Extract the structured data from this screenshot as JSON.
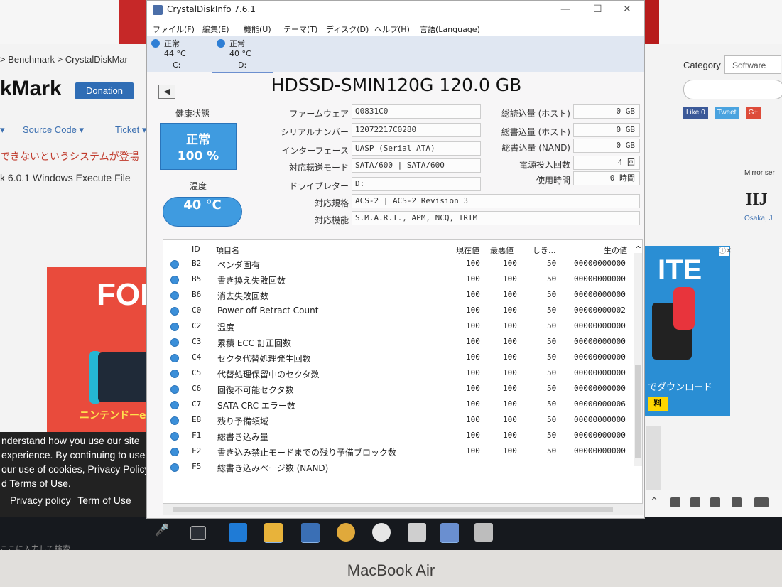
{
  "browser": {
    "breadcrumb": "> Benchmark > CrystalDiskMar",
    "site_title": "kMark",
    "donation_label": "Donation",
    "nav_source": "Source Code",
    "nav_ticket": "Ticket",
    "red_text": "できないというシステムが登場",
    "exec_text": "k 6.0.1 Windows Execute File",
    "category_label": "Category",
    "category_value": "Software",
    "like_label": "Like 0",
    "tweet_label": "Tweet",
    "gplus_label": "G+",
    "mirror_label": "Mirror ser",
    "iij_label": "IIJ",
    "osaka_label": "Osaka, J",
    "ad_left_big": "FORT",
    "ad_left_bottom": "ニンテンドーeショ",
    "ad_right_big": "ITE",
    "ad_right_download": "でダウンロード",
    "ad_right_buy": "料",
    "ad_close": "ⓘ✕",
    "cookie_lines": [
      "nderstand how you use our site",
      " experience. By continuing to use",
      " our use of cookies, Privacy Policy",
      "d Terms of Use."
    ],
    "privacy_link": "Privacy policy",
    "terms_link": "Term of Use"
  },
  "window": {
    "title": "CrystalDiskInfo 7.6.1",
    "minimize": "—",
    "maximize": "☐",
    "close": "✕",
    "menus": [
      "ファイル(F)",
      "編集(E)",
      "機能(U)",
      "テーマ(T)",
      "ディスク(D)",
      "ヘルプ(H)",
      "言語(Language)"
    ],
    "drives": [
      {
        "status": "正常",
        "temp": "44 °C",
        "letter": "C:"
      },
      {
        "status": "正常",
        "temp": "40 °C",
        "letter": "D:"
      }
    ],
    "prev_arrow": "◀",
    "model": "HDSSD-SMIN120G 120.0 GB",
    "health_label": "健康状態",
    "health_status": "正常",
    "health_percent": "100 %",
    "temp_label": "温度",
    "temp_value": "40 °C",
    "info": {
      "firmware_label": "ファームウェア",
      "firmware": "Q0831C0",
      "serial_label": "シリアルナンバー",
      "serial": "12072217C0280",
      "interface_label": "インターフェース",
      "interface": "UASP (Serial ATA)",
      "transfer_label": "対応転送モード",
      "transfer": "SATA/600 | SATA/600",
      "drive_label": "ドライブレター",
      "drive": "D:",
      "standard_label": "対応規格",
      "standard": "ACS-2 | ACS-2 Revision 3",
      "features_label": "対応機能",
      "features": "S.M.A.R.T., APM, NCQ, TRIM"
    },
    "stats": {
      "host_reads_label": "総読込量 (ホスト)",
      "host_reads": "0 GB",
      "host_writes_label": "総書込量 (ホスト)",
      "host_writes": "0 GB",
      "nand_writes_label": "総書込量 (NAND)",
      "nand_writes": "0 GB",
      "power_count_label": "電源投入回数",
      "power_count": "4 回",
      "hours_label": "使用時間",
      "hours": "0 時間"
    },
    "smart_headers": {
      "id": "ID",
      "name": "項目名",
      "current": "現在値",
      "worst": "最悪値",
      "threshold": "しき...",
      "raw": "生の値"
    },
    "smart_rows": [
      {
        "id": "B2",
        "name": "ベンダ固有",
        "current": "100",
        "worst": "100",
        "threshold": "50",
        "raw": "00000000000"
      },
      {
        "id": "B5",
        "name": "書き換え失敗回数",
        "current": "100",
        "worst": "100",
        "threshold": "50",
        "raw": "00000000000"
      },
      {
        "id": "B6",
        "name": "消去失敗回数",
        "current": "100",
        "worst": "100",
        "threshold": "50",
        "raw": "00000000000"
      },
      {
        "id": "C0",
        "name": "Power-off Retract Count",
        "current": "100",
        "worst": "100",
        "threshold": "50",
        "raw": "00000000002"
      },
      {
        "id": "C2",
        "name": "温度",
        "current": "100",
        "worst": "100",
        "threshold": "50",
        "raw": "00000000000"
      },
      {
        "id": "C3",
        "name": "累積 ECC 訂正回数",
        "current": "100",
        "worst": "100",
        "threshold": "50",
        "raw": "00000000000"
      },
      {
        "id": "C4",
        "name": "セクタ代替処理発生回数",
        "current": "100",
        "worst": "100",
        "threshold": "50",
        "raw": "00000000000"
      },
      {
        "id": "C5",
        "name": "代替処理保留中のセクタ数",
        "current": "100",
        "worst": "100",
        "threshold": "50",
        "raw": "00000000000"
      },
      {
        "id": "C6",
        "name": "回復不可能セクタ数",
        "current": "100",
        "worst": "100",
        "threshold": "50",
        "raw": "00000000000"
      },
      {
        "id": "C7",
        "name": "SATA CRC エラー数",
        "current": "100",
        "worst": "100",
        "threshold": "50",
        "raw": "00000000006"
      },
      {
        "id": "E8",
        "name": "残り予備領域",
        "current": "100",
        "worst": "100",
        "threshold": "50",
        "raw": "00000000000"
      },
      {
        "id": "F1",
        "name": "総書き込み量",
        "current": "100",
        "worst": "100",
        "threshold": "50",
        "raw": "00000000000"
      },
      {
        "id": "F2",
        "name": "書き込み禁止モードまでの残り予備ブロック数",
        "current": "100",
        "worst": "100",
        "threshold": "50",
        "raw": "00000000000"
      },
      {
        "id": "F5",
        "name": "総書き込みページ数 (NAND)",
        "current": "",
        "worst": "",
        "threshold": "",
        "raw": ""
      }
    ]
  },
  "taskbar": {
    "search_hint": "ここに入力して検索",
    "laptop_label": "MacBook Air"
  },
  "colors": {
    "accent": "#3f9be0",
    "health_ok": "#3f9be0",
    "taskbar": "#16191e"
  }
}
